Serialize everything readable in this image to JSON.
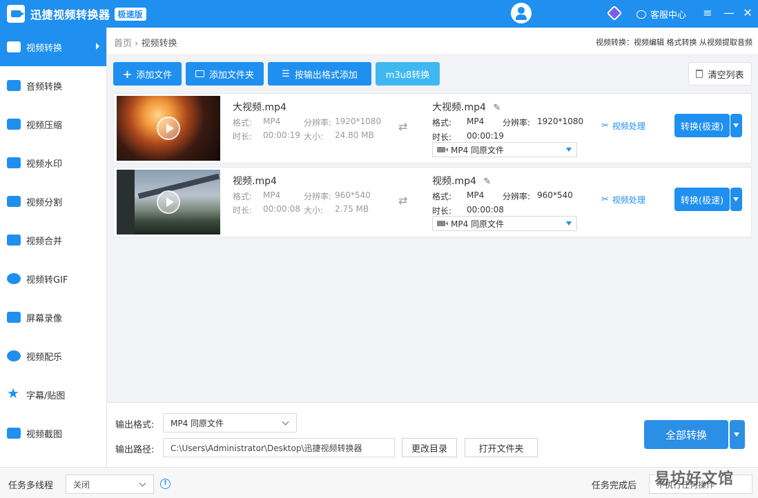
{
  "app": {
    "title": "迅捷视频转换器",
    "edition_badge": "极速版",
    "service_label": "客服中心",
    "menu_icon": "≡",
    "minimize_icon": "—",
    "close_icon": "✕"
  },
  "sidebar": {
    "items": [
      {
        "label": "视频转换",
        "icon": "video-convert-icon",
        "active": true
      },
      {
        "label": "音频转换",
        "icon": "audio-convert-icon"
      },
      {
        "label": "视频压缩",
        "icon": "video-compress-icon"
      },
      {
        "label": "视频水印",
        "icon": "video-watermark-icon"
      },
      {
        "label": "视频分割",
        "icon": "video-split-icon"
      },
      {
        "label": "视频合并",
        "icon": "video-merge-icon"
      },
      {
        "label": "视频转GIF",
        "icon": "video-gif-icon"
      },
      {
        "label": "屏幕录像",
        "icon": "screen-record-icon"
      },
      {
        "label": "视频配乐",
        "icon": "video-music-icon"
      },
      {
        "label": "字幕/贴图",
        "icon": "subtitle-sticker-icon"
      },
      {
        "label": "视频截图",
        "icon": "video-screenshot-icon"
      }
    ]
  },
  "breadcrumb": {
    "home": "首页",
    "separator": "›",
    "current": "视频转换",
    "right_text": "视频转换：视频编辑 格式转换 从视频提取音频"
  },
  "toolbar": {
    "add_file": "添加文件",
    "add_folder": "添加文件夹",
    "add_by_format": "按输出格式添加",
    "m3u8": "m3u8转换",
    "clear_list": "清空列表"
  },
  "labels": {
    "format": "格式:",
    "resolution": "分辨率:",
    "duration": "时长:",
    "size": "大小:",
    "video_process": "视频处理",
    "convert_fast": "转换(极速)"
  },
  "files": [
    {
      "src_name": "大视频.mp4",
      "src_format": "MP4",
      "src_resolution": "1920*1080",
      "src_duration": "00:00:19",
      "src_size": "24.80 MB",
      "dst_name": "大视频.mp4",
      "dst_format": "MP4",
      "dst_resolution": "1920*1080",
      "dst_duration": "00:00:19",
      "dst_select": "MP4   同原文件"
    },
    {
      "src_name": "视频.mp4",
      "src_format": "MP4",
      "src_resolution": "960*540",
      "src_duration": "00:00:08",
      "src_size": "2.75 MB",
      "dst_name": "视频.mp4",
      "dst_format": "MP4",
      "dst_resolution": "960*540",
      "dst_duration": "00:00:08",
      "dst_select": "MP4   同原文件"
    }
  ],
  "bottom": {
    "output_format_label": "输出格式:",
    "output_format_value": "MP4   同原文件",
    "output_path_label": "输出路径:",
    "output_path_value": "C:\\Users\\Administrator\\Desktop\\迅捷视频转换器",
    "change_dir": "更改目录",
    "open_folder": "打开文件夹",
    "convert_all": "全部转换"
  },
  "statusbar": {
    "multithread_label": "任务多线程",
    "multithread_value": "关闭",
    "after_done_label": "任务完成后",
    "after_done_value": "不执行任何操作"
  },
  "watermark": "易坊好文馆",
  "colors": {
    "accent": "#1f8ff0",
    "accent_light": "#3fb8f2"
  }
}
